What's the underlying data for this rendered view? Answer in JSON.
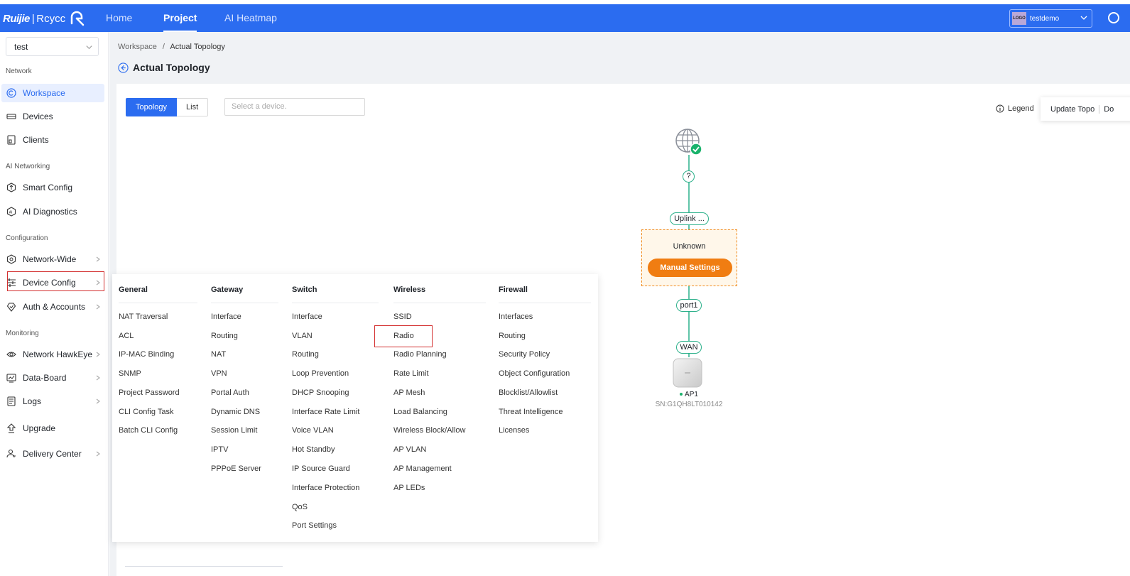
{
  "topbar": {
    "brand": "Ruijie",
    "brand_sep": "|",
    "brand_sub": "Rcycc",
    "nav": [
      "Home",
      "Project",
      "AI Heatmap"
    ],
    "active_nav": "Project",
    "account": {
      "logo_text": "LOGO",
      "name": "testdemo"
    }
  },
  "sidebar": {
    "project": "test",
    "sections": {
      "network": "Network",
      "ai": "AI Networking",
      "config": "Configuration",
      "monitoring": "Monitoring"
    },
    "items": {
      "workspace": "Workspace",
      "devices": "Devices",
      "clients": "Clients",
      "smart_config": "Smart Config",
      "ai_diagnostics": "AI Diagnostics",
      "network_wide": "Network-Wide",
      "device_config": "Device Config",
      "auth_accounts": "Auth & Accounts",
      "network_hawkeye": "Network HawkEye",
      "data_board": "Data-Board",
      "logs": "Logs",
      "upgrade": "Upgrade",
      "delivery_center": "Delivery Center"
    }
  },
  "main": {
    "breadcrumb": {
      "root": "Workspace",
      "sep": "/",
      "current": "Actual Topology"
    },
    "title": "Actual Topology",
    "view_toggle": {
      "topology": "Topology",
      "list": "List"
    },
    "device_search_placeholder": "Select a device.",
    "legend": "Legend",
    "update_topo": "Update Topo",
    "update_cut": "Do"
  },
  "topology": {
    "unknown_link": "?",
    "uplink": "Uplink ...",
    "unknown_label": "Unknown",
    "manual_settings": "Manual Settings",
    "port": "port1",
    "wan": "WAN",
    "ap_name": "AP1",
    "ap_sn": "SN:G1QH8LT010142"
  },
  "menu": {
    "general": {
      "title": "General",
      "items": [
        "NAT Traversal",
        "ACL",
        "IP-MAC Binding",
        "SNMP",
        "Project Password",
        "CLI Config Task",
        "Batch CLI Config"
      ]
    },
    "gateway": {
      "title": "Gateway",
      "items": [
        "Interface",
        "Routing",
        "NAT",
        "VPN",
        "Portal Auth",
        "Dynamic DNS",
        "Session Limit",
        "IPTV",
        "PPPoE Server"
      ]
    },
    "switch": {
      "title": "Switch",
      "items": [
        "Interface",
        "VLAN",
        "Routing",
        "Loop Prevention",
        "DHCP Snooping",
        "Interface Rate Limit",
        "Voice VLAN",
        "Hot Standby",
        "IP Source Guard",
        "Interface Protection",
        "QoS",
        "Port Settings"
      ]
    },
    "wireless": {
      "title": "Wireless",
      "items": [
        "SSID",
        "Radio",
        "Radio Planning",
        "Rate Limit",
        "AP Mesh",
        "Load Balancing",
        "Wireless Block/Allow",
        "AP VLAN",
        "AP Management",
        "AP LEDs"
      ]
    },
    "firewall": {
      "title": "Firewall",
      "items": [
        "Interfaces",
        "Routing",
        "Security Policy",
        "Object Configuration",
        "Blocklist/Allowlist",
        "Threat Intelligence",
        "Licenses"
      ]
    }
  },
  "colors": {
    "accent": "#2b6cf0",
    "link_green": "#2bb08a",
    "warning_orange": "#f07d12",
    "highlight_red": "#d32f2f"
  }
}
